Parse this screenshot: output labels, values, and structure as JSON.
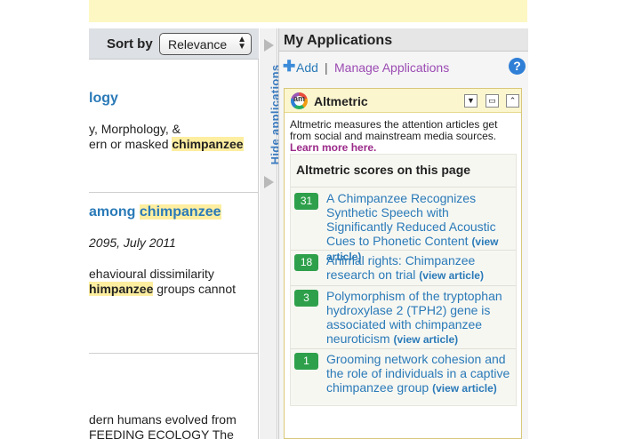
{
  "sort": {
    "label": "Sort by",
    "selected": "Relevance"
  },
  "results": [
    {
      "title": "logy",
      "lines": [
        "y, Morphology, &",
        "ern or masked"
      ],
      "highlight": "chimpanzee"
    },
    {
      "title_prefix": "among",
      "title_highlight": "chimpanzee",
      "citation": "2095, July 2011",
      "line1": "ehavioural dissimilarity",
      "line2_highlight": "chimpanzee",
      "line2_rest": "groups cannot",
      "line2_prefix": "hi"
    },
    {
      "line1": "dern humans evolved from",
      "line2": "FEEDING ECOLOGY The"
    }
  ],
  "hide_applications": "Hide applications",
  "apps": {
    "header": "My Applications",
    "add_label": "Add",
    "separator": "|",
    "manage_label": "Manage Applications",
    "help": "?",
    "widget": {
      "logo_text": "am",
      "title": "Altmetric",
      "description": "Altmetric measures the attention articles get from social and mainstream media sources.",
      "learn_more": "Learn more here.",
      "scores_title": "Altmetric scores on this page",
      "items": [
        {
          "score": "31",
          "text": "A Chimpanzee Recognizes Synthetic Speech with Significantly Reduced Acoustic Cues to Phonetic Content",
          "view": "(view article)"
        },
        {
          "score": "18",
          "text": "Animal rights: Chimpanzee research on trial",
          "view": "(view article)"
        },
        {
          "score": "3",
          "text": "Polymorphism of the tryptophan hydroxylase 2 (TPH2) gene is associated with chimpanzee neuroticism",
          "view": "(view article)"
        },
        {
          "score": "1",
          "text": "Grooming network cohesion and the role of individuals in a captive chimpanzee group",
          "view": "(view article)"
        }
      ]
    }
  },
  "colors": {
    "accent": "#2a7ab8",
    "highlight": "#fdeea0",
    "badge": "#2ea04b",
    "banner": "#fdf7c3"
  }
}
